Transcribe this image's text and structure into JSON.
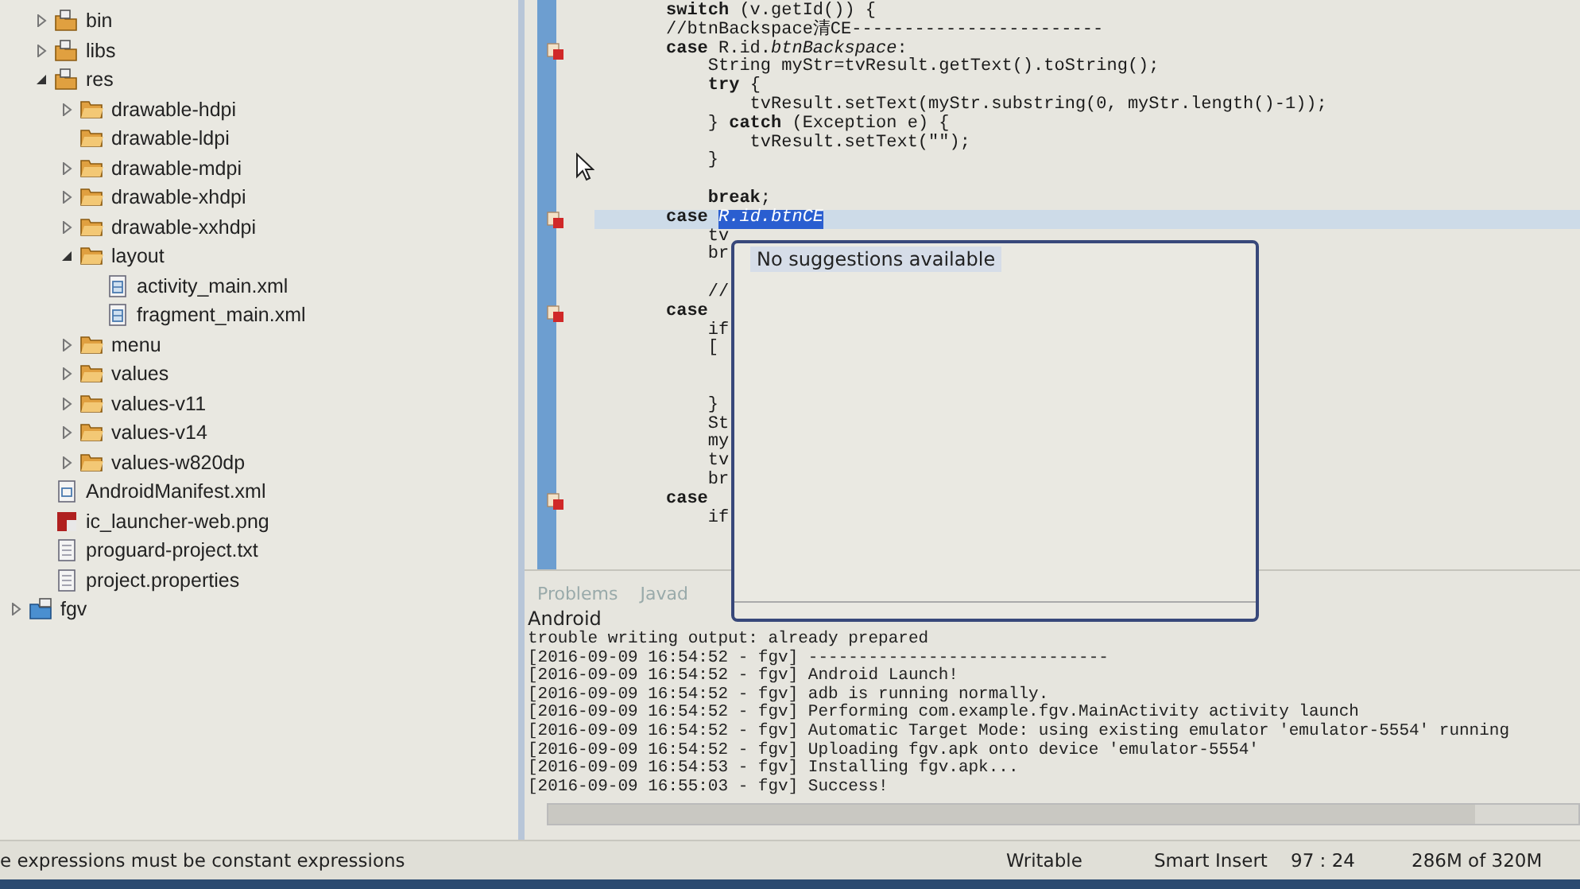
{
  "project_tree": [
    {
      "label": "bin",
      "kind": "package-folder",
      "expanded": false
    },
    {
      "label": "libs",
      "kind": "package-folder",
      "expanded": false
    },
    {
      "label": "res",
      "kind": "package-folder",
      "expanded": true,
      "children": [
        {
          "label": "drawable-hdpi",
          "kind": "folder",
          "expanded": false
        },
        {
          "label": "drawable-ldpi",
          "kind": "folder"
        },
        {
          "label": "drawable-mdpi",
          "kind": "folder",
          "expanded": false
        },
        {
          "label": "drawable-xhdpi",
          "kind": "folder",
          "expanded": false
        },
        {
          "label": "drawable-xxhdpi",
          "kind": "folder",
          "expanded": false
        },
        {
          "label": "layout",
          "kind": "folder",
          "expanded": true,
          "children": [
            {
              "label": "activity_main.xml",
              "kind": "layout-file"
            },
            {
              "label": "fragment_main.xml",
              "kind": "layout-file"
            }
          ]
        },
        {
          "label": "menu",
          "kind": "folder",
          "expanded": false
        },
        {
          "label": "values",
          "kind": "folder",
          "expanded": false
        },
        {
          "label": "values-v11",
          "kind": "folder",
          "expanded": false
        },
        {
          "label": "values-v14",
          "kind": "folder",
          "expanded": false
        },
        {
          "label": "values-w820dp",
          "kind": "folder",
          "expanded": false
        }
      ]
    },
    {
      "label": "AndroidManifest.xml",
      "kind": "xml-file"
    },
    {
      "label": "ic_launcher-web.png",
      "kind": "image-file"
    },
    {
      "label": "proguard-project.txt",
      "kind": "text-file"
    },
    {
      "label": "project.properties",
      "kind": "text-file"
    }
  ],
  "projects": [
    {
      "label": "fgv",
      "kind": "project",
      "expanded": false
    }
  ],
  "editor": {
    "lines": [
      {
        "text": "**switch** (v.getId()) {",
        "error": false,
        "current": false
      },
      {
        "text": "//btnBackspace清CE------------------------",
        "error": false,
        "current": false
      },
      {
        "text": "**case** R.id.*btnBackspace*:",
        "error": true,
        "current": false
      },
      {
        "text": "    String myStr=tvResult.getText().toString();",
        "error": false,
        "current": false
      },
      {
        "text": "    **try** {",
        "error": false,
        "current": false
      },
      {
        "text": "        tvResult.setText(myStr.substring(0, myStr.length()-1));",
        "error": false,
        "current": false
      },
      {
        "text": "    } **catch** (Exception e) {",
        "error": false,
        "current": false
      },
      {
        "text": "        tvResult.setText(\"\");",
        "error": false,
        "current": false
      },
      {
        "text": "    }",
        "error": false,
        "current": false
      },
      {
        "error": false,
        "current": false
      },
      {
        "text": "    **break**;",
        "error": false,
        "current": false
      },
      {
        "text": "**case** ",
        "selection": "R.id.btnCE",
        "error": true,
        "current": true
      },
      {
        "text": "    tv",
        "error": false,
        "current": false
      },
      {
        "text": "    br",
        "error": false,
        "current": false
      },
      {
        "error": false,
        "current": false
      },
      {
        "text": "    //",
        "error": false,
        "current": false
      },
      {
        "text": "**case**",
        "error": true,
        "current": false
      },
      {
        "text": "    if",
        "error": false,
        "current": false
      },
      {
        "text": "    [",
        "error": false,
        "current": false
      },
      {
        "error": false,
        "current": false
      },
      {
        "error": false,
        "current": false
      },
      {
        "text": "    }",
        "error": false,
        "current": false
      },
      {
        "text": "    St",
        "error": false,
        "current": false
      },
      {
        "text": "    my",
        "error": false,
        "current": false
      },
      {
        "text": "    tv",
        "error": false,
        "current": false
      },
      {
        "text": "    br",
        "error": false,
        "current": false
      },
      {
        "text": "**case**",
        "error": true,
        "current": false
      },
      {
        "text": "    if",
        "error": false,
        "current": false
      }
    ]
  },
  "suggestion_popup": {
    "message": "No suggestions available"
  },
  "bottom_tabs": [
    {
      "label": "Problems",
      "selected": false
    },
    {
      "label": "Javad",
      "selected": false
    }
  ],
  "console": {
    "title": "Android",
    "lines": [
      "trouble writing output: already prepared",
      "[2016-09-09 16:54:52 - fgv] ------------------------------",
      "[2016-09-09 16:54:52 - fgv] Android Launch!",
      "[2016-09-09 16:54:52 - fgv] adb is running normally.",
      "[2016-09-09 16:54:52 - fgv] Performing com.example.fgv.MainActivity activity launch",
      "[2016-09-09 16:54:52 - fgv] Automatic Target Mode: using existing emulator 'emulator-5554' running",
      "[2016-09-09 16:54:52 - fgv] Uploading fgv.apk onto device 'emulator-5554'",
      "[2016-09-09 16:54:53 - fgv] Installing fgv.apk...",
      "[2016-09-09 16:55:03 - fgv] Success!"
    ]
  },
  "status_bar": {
    "message": "e expressions must be constant expressions",
    "mode": "Writable",
    "insert_mode": "Smart Insert",
    "position": "97 : 24",
    "memory": "286M of 320M"
  }
}
